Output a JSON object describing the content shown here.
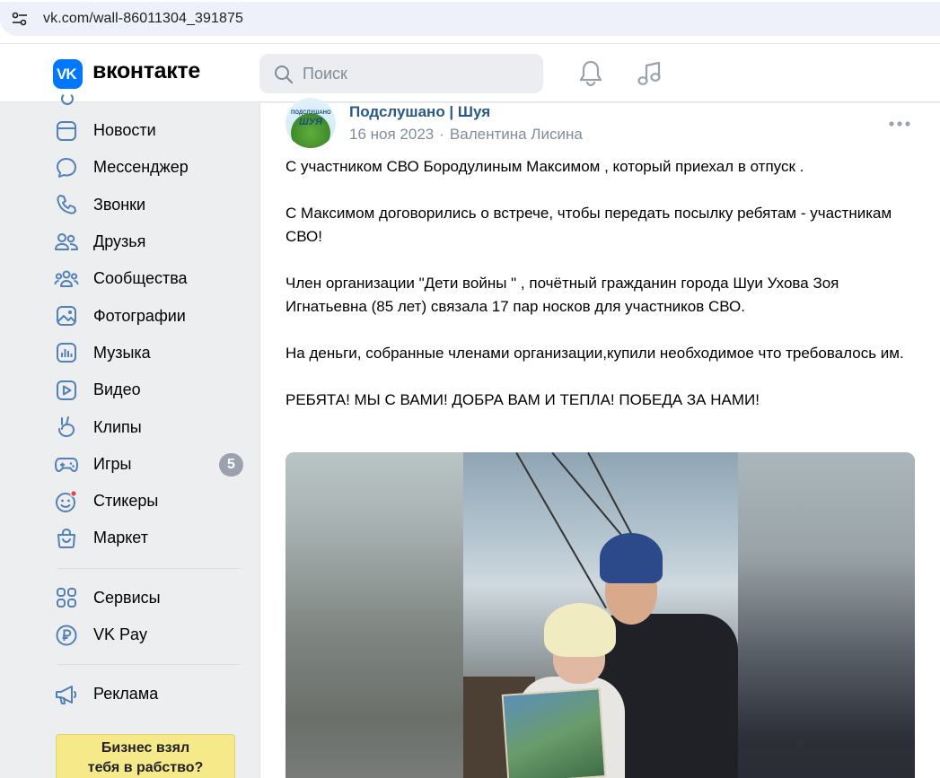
{
  "browser": {
    "url": "vk.com/wall-86011304_391875"
  },
  "header": {
    "logo_mark": "VK",
    "logo_text": "вконтакте",
    "search_placeholder": "Поиск"
  },
  "sidebar": {
    "items": [
      {
        "label": "Новости",
        "icon": "newspaper-icon"
      },
      {
        "label": "Мессенджер",
        "icon": "message-icon"
      },
      {
        "label": "Звонки",
        "icon": "phone-icon"
      },
      {
        "label": "Друзья",
        "icon": "friends-icon"
      },
      {
        "label": "Сообщества",
        "icon": "communities-icon"
      },
      {
        "label": "Фотографии",
        "icon": "photo-icon"
      },
      {
        "label": "Музыка",
        "icon": "music-icon"
      },
      {
        "label": "Видео",
        "icon": "video-icon"
      },
      {
        "label": "Клипы",
        "icon": "clips-icon"
      },
      {
        "label": "Игры",
        "icon": "gamepad-icon",
        "badge": "5"
      },
      {
        "label": "Стикеры",
        "icon": "sticker-icon"
      },
      {
        "label": "Маркет",
        "icon": "bag-icon"
      }
    ],
    "services": [
      {
        "label": "Сервисы",
        "icon": "grid-icon"
      },
      {
        "label": "VK Pay",
        "icon": "ruble-icon"
      }
    ],
    "ads": [
      {
        "label": "Реклама",
        "icon": "megaphone-icon"
      }
    ],
    "ad_banner": {
      "line1": "Бизнес взял",
      "line2": "тебя в рабство?"
    }
  },
  "post": {
    "avatar_line1": "ПОДСЛУШАНО",
    "avatar_line2": "ШУЯ",
    "author": "Подслушано | Шуя",
    "date": "16 ноя 2023",
    "separator": "·",
    "signer": "Валентина Лисина",
    "paragraphs": [
      "С участником СВО Бородулиным Максимом , который приехал в отпуск .",
      "С Максимом договорились о встрече, чтобы передать посылку ребятам - участникам СВО!",
      "Член организации \"Дети войны \" , почётный гражданин города Шуи Ухова Зоя Игнатьевна (85 лет) связала 17 пар носков для участников СВО.",
      "На деньги, собранные членами организации,купили необходимое что требовалось им.",
      "РЕБЯТА! МЫ С ВАМИ! ДОБРА ВАМ И ТЕПЛА! ПОБЕДА ЗА НАМИ!"
    ]
  },
  "colors": {
    "accent": "#0077ff",
    "link": "#2a5885",
    "muted": "#818c99",
    "icon": "#5181b8",
    "background": "#edeef0"
  }
}
